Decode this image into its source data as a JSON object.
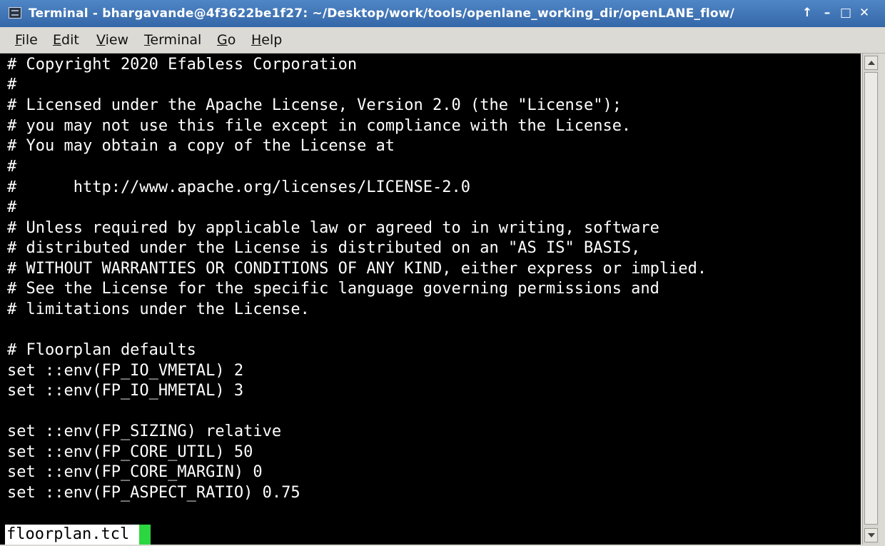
{
  "window": {
    "title": "Terminal - bhargavande@4f3622be1f27: ~/Desktop/work/tools/openlane_working_dir/openLANE_flow/",
    "controls": {
      "pin": "↑",
      "minimize": "–",
      "maximize": "□",
      "close": "✕"
    }
  },
  "menu": {
    "items": [
      {
        "label_u": "F",
        "label_rest": "ile"
      },
      {
        "label_u": "E",
        "label_rest": "dit"
      },
      {
        "label_u": "V",
        "label_rest": "iew"
      },
      {
        "label_u": "T",
        "label_rest": "erminal"
      },
      {
        "label_u": "G",
        "label_rest": "o"
      },
      {
        "label_u": "H",
        "label_rest": "elp"
      }
    ]
  },
  "terminal": {
    "lines": [
      "# Copyright 2020 Efabless Corporation",
      "#",
      "# Licensed under the Apache License, Version 2.0 (the \"License\");",
      "# you may not use this file except in compliance with the License.",
      "# You may obtain a copy of the License at",
      "#",
      "#      http://www.apache.org/licenses/LICENSE-2.0",
      "#",
      "# Unless required by applicable law or agreed to in writing, software",
      "# distributed under the License is distributed on an \"AS IS\" BASIS,",
      "# WITHOUT WARRANTIES OR CONDITIONS OF ANY KIND, either express or implied.",
      "# See the License for the specific language governing permissions and",
      "# limitations under the License.",
      "",
      "# Floorplan defaults",
      "set ::env(FP_IO_VMETAL) 2",
      "set ::env(FP_IO_HMETAL) 3",
      "",
      "set ::env(FP_SIZING) relative",
      "set ::env(FP_CORE_UTIL) 50",
      "set ::env(FP_CORE_MARGIN) 0",
      "set ::env(FP_ASPECT_RATIO) 0.75"
    ],
    "status_filename": "floorplan.tcl",
    "cursor_color": "#2bd641"
  }
}
